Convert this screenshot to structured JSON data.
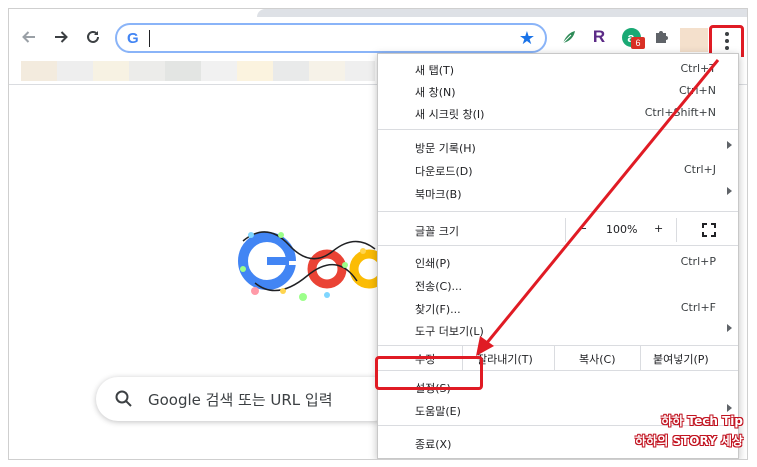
{
  "omnibox": {
    "favicon_letter": "G",
    "value": ""
  },
  "extensions": [
    {
      "name": "leaf-extension-icon"
    },
    {
      "letter": "R"
    },
    {
      "letter": "a",
      "badge": "6"
    },
    {
      "name": "puzzle-icon"
    }
  ],
  "colors": {
    "accent": "#1a73e8",
    "highlight_red": "#e01b24",
    "menu_border": "#c8c8c8"
  },
  "search": {
    "placeholder": "Google 검색 또는 URL 입력"
  },
  "menu": {
    "items": [
      {
        "label": "새 탭(T)",
        "shortcut": "Ctrl+T"
      },
      {
        "label": "새 창(N)",
        "shortcut": "Ctrl+N"
      },
      {
        "label": "새 시크릿 창(I)",
        "shortcut": "Ctrl+Shift+N"
      },
      {
        "label": "방문 기록(H)",
        "submenu": true
      },
      {
        "label": "다운로드(D)",
        "shortcut": "Ctrl+J"
      },
      {
        "label": "북마크(B)",
        "submenu": true
      },
      {
        "label": "인쇄(P)",
        "shortcut": "Ctrl+P"
      },
      {
        "label": "전송(C)..."
      },
      {
        "label": "찾기(F)...",
        "shortcut": "Ctrl+F"
      },
      {
        "label": "도구 더보기(L)",
        "submenu": true
      },
      {
        "label": "설정(S)"
      },
      {
        "label": "도움말(E)",
        "submenu": true
      },
      {
        "label": "종료(X)"
      }
    ],
    "zoom": {
      "label": "글꼴 크기",
      "minus": "−",
      "value": "100%",
      "plus": "+"
    },
    "edit": {
      "label": "수정",
      "cut": "잘라내기(T)",
      "copy": "복사(C)",
      "paste": "붙여넣기(P)"
    }
  },
  "watermark": {
    "line1": "하하 Tech Tip",
    "line2": "하하의 STORY 세상"
  }
}
